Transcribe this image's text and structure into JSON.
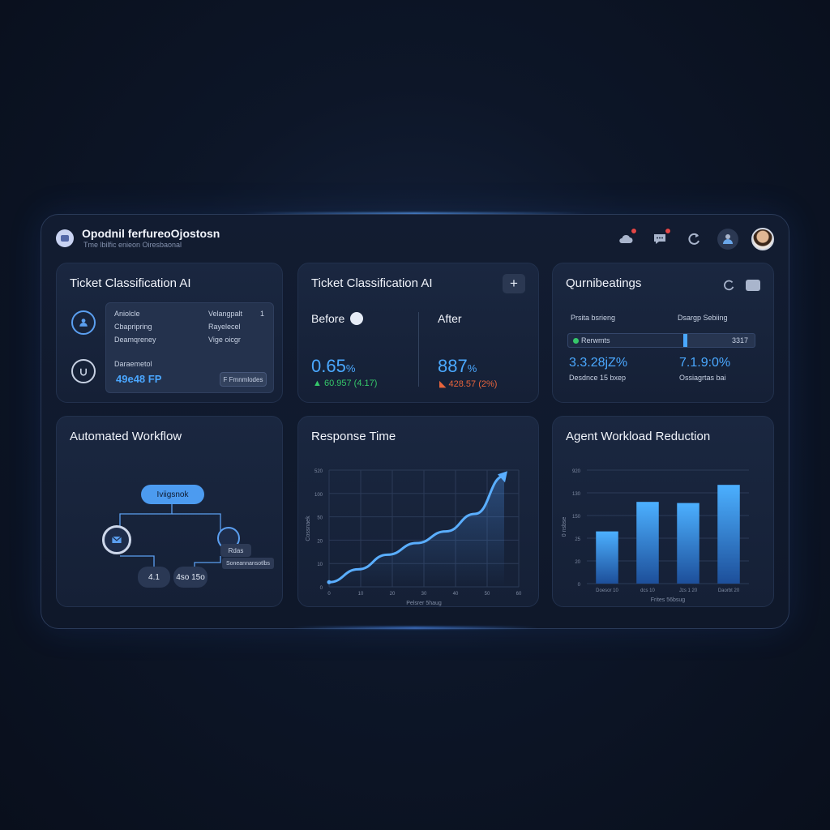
{
  "app": {
    "title": "Opodnil ferfureoOjostosn",
    "subtitle": "Tme lbilfic enieon Oiresbaonal"
  },
  "header_icons": [
    "cloud-icon",
    "chat-icon",
    "refresh-icon",
    "user-group-icon",
    "avatar"
  ],
  "card1": {
    "title": "Ticket Classification AI",
    "row1_left": "Aniolcle",
    "row1_right": "Velangpalt",
    "row1_count": "1",
    "row2_left": "Cbapripring",
    "row2_right": "Rayelecel",
    "row3_left": "Deamqreney",
    "row3_right": "Vige oicgr",
    "label": "Daraemetol",
    "value": "49e48 FP",
    "button": "F Fmnmlodes"
  },
  "card2": {
    "title": "Ticket Classification AI",
    "plus": "+",
    "before_label": "Before",
    "after_label": "After",
    "before_value": "0.65",
    "before_unit": "%",
    "after_value": "887",
    "after_unit": "%",
    "before_delta": "60.957 (4.17)",
    "after_delta": "428.57 (2%)",
    "before_delta_color": "#36c86a",
    "after_delta_color": "#e8643c"
  },
  "card3": {
    "title": "Qurnibeatings",
    "left_label": "Prsita bsrieng",
    "right_label": "Dsargp Sebiing",
    "bar_label": "Rerwmts",
    "bar_value": "3317",
    "progress": 0.63,
    "left_value": "3.3.28jZ%",
    "right_value": "7.1.9:0%",
    "left_caption": "Desdnce 15 bxep",
    "right_caption": "Ossiagrtas bai"
  },
  "workflow": {
    "title": "Automated Workflow",
    "top_node": "Iviigsnok",
    "right_node": "Rdas",
    "right_node_caption": "Soneannansotlbs",
    "bottom_left": "4.1",
    "bottom_right": "4so 15o"
  },
  "response_time": {
    "title": "Response Time"
  },
  "workload": {
    "title": "Agent Workload Reduction"
  },
  "chart_data": [
    {
      "type": "line",
      "title": "Response Time",
      "xlabel": "Pelsrer 5haug",
      "ylabel": "Cossnaek",
      "x": [
        0,
        10,
        20,
        30,
        40,
        50,
        60
      ],
      "y": [
        8,
        30,
        55,
        75,
        95,
        125,
        190
      ],
      "xlim": [
        0,
        65
      ],
      "ylim": [
        0,
        200
      ],
      "ytick_labels": [
        "0",
        "10",
        "20",
        "50",
        "100",
        "520"
      ],
      "xtick_labels": [
        "0",
        "10",
        "20",
        "30",
        "40",
        "50",
        "60"
      ],
      "grid": true
    },
    {
      "type": "bar",
      "title": "Agent Workload Reduction",
      "xlabel": "Frites 56bsug",
      "ylabel": "0 nsbse",
      "categories": [
        "Doesor 10",
        "dcs 10",
        "Jzs 1 20",
        "Daorbt 20"
      ],
      "values": [
        46,
        72,
        71,
        87
      ],
      "ylim": [
        0,
        100
      ],
      "ytick_labels": [
        "0",
        "20",
        "25",
        "150",
        "130",
        "920"
      ],
      "grid": true
    }
  ]
}
